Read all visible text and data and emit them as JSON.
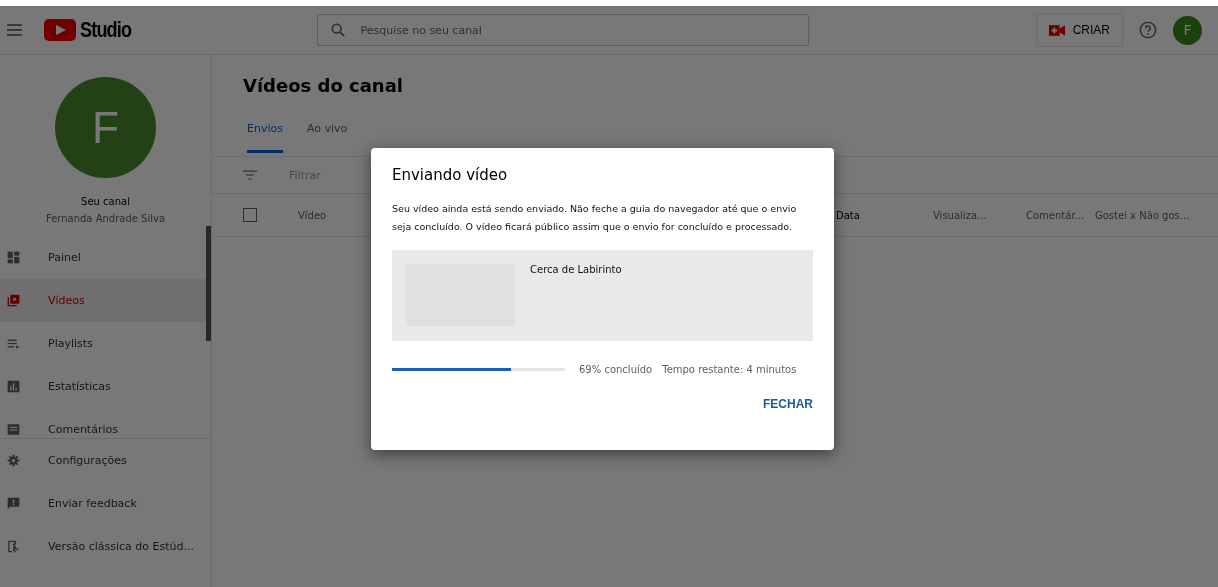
{
  "header": {
    "logo": "Studio",
    "search": {
      "placeholder": "Pesquise no seu canal"
    },
    "create_button": "CRIAR",
    "avatar": "F"
  },
  "sidebar": {
    "avatar": "F",
    "channel_label": "Seu canal",
    "channel_name": "Fernanda Andrade Silva",
    "items": [
      {
        "label": "Painel",
        "selected": false
      },
      {
        "label": "Vídeos",
        "selected": true
      },
      {
        "label": "Playlists",
        "selected": false
      },
      {
        "label": "Estatísticas",
        "selected": false
      },
      {
        "label": "Comentários",
        "selected": false
      }
    ],
    "footer_items": [
      {
        "label": "Configurações"
      },
      {
        "label": "Enviar feedback"
      },
      {
        "label": "Versão clássica do Estúd..."
      }
    ]
  },
  "main": {
    "title": "Vídeos do canal",
    "tabs": [
      {
        "label": "Envios",
        "selected": true
      },
      {
        "label": "Ao vivo",
        "selected": false
      }
    ],
    "filter": {
      "placeholder": "Filtrar"
    },
    "table": {
      "select_all_checked": false,
      "columns": [
        {
          "label": "Vídeo"
        },
        {
          "label": "Data"
        },
        {
          "label": "Visualiza..."
        },
        {
          "label": "Comentár..."
        },
        {
          "label": "Gostei x Não gos..."
        }
      ]
    }
  },
  "dialog": {
    "title": "Enviando vídeo",
    "message": "Seu vídeo ainda está sendo enviado. Não feche a guia do navegador até que o envio seja concluído. O vídeo ficará público assim que o envio for concluído e processado.",
    "video_title": "Cerca de Labirinto",
    "progress": {
      "level": 0.69,
      "percent": "69% concluído",
      "remaining": "Tempo restante: 4 minutos"
    },
    "close_button": "FECHAR"
  }
}
